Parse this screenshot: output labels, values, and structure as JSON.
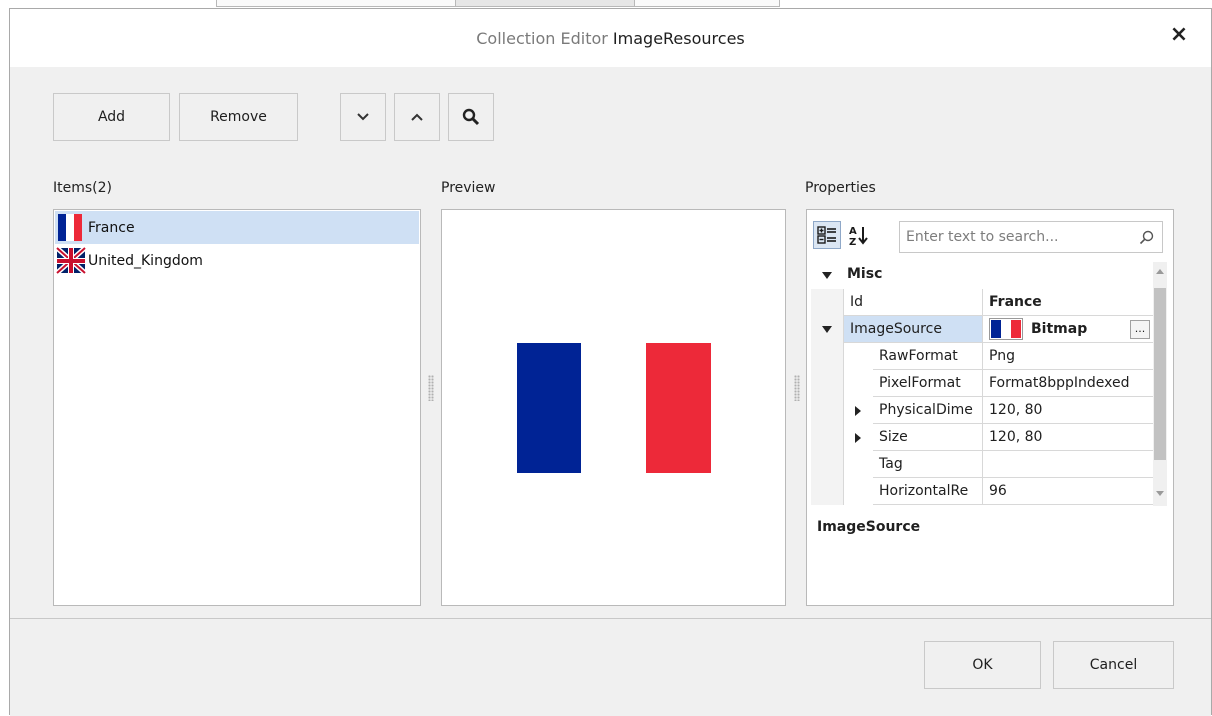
{
  "dialog": {
    "title_prefix": "Collection Editor",
    "title_name": "ImageResources",
    "close_glyph": "×"
  },
  "toolbar": {
    "add_label": "Add",
    "remove_label": "Remove",
    "move_down_icon": "chevron-down-icon",
    "move_up_icon": "chevron-up-icon",
    "search_icon": "magnifier-icon"
  },
  "items": {
    "header": "Items(2)",
    "list": [
      {
        "label": "France",
        "icon": "france-flag-icon",
        "selected": true
      },
      {
        "label": "United_Kingdom",
        "icon": "uk-flag-icon",
        "selected": false
      }
    ]
  },
  "preview": {
    "header": "Preview",
    "image": "france-flag",
    "colors": {
      "blue": "#002395",
      "white": "#ffffff",
      "red": "#ed2939"
    }
  },
  "properties": {
    "header": "Properties",
    "search_placeholder": "Enter text to search...",
    "category_label": "Misc",
    "rows": [
      {
        "name": "Id",
        "value": "France",
        "bold_value": true,
        "expander": "none",
        "level": 0
      },
      {
        "name": "ImageSource",
        "value": "Bitmap",
        "bold_value": true,
        "expander": "expanded",
        "level": 0,
        "selected": true,
        "has_ellipsis": true,
        "ellipsis_label": "..."
      },
      {
        "name": "RawFormat",
        "value": "Png",
        "expander": "none",
        "level": 1
      },
      {
        "name": "PixelFormat",
        "value": "Format8bppIndexed",
        "expander": "none",
        "level": 1
      },
      {
        "name": "PhysicalDime",
        "value": "120, 80",
        "expander": "collapsed",
        "level": 1
      },
      {
        "name": "Size",
        "value": "120, 80",
        "expander": "collapsed",
        "level": 1
      },
      {
        "name": "Tag",
        "value": "",
        "expander": "none",
        "level": 1
      },
      {
        "name": "HorizontalRe",
        "value": "96",
        "expander": "none",
        "level": 1
      }
    ],
    "description_title": "ImageSource"
  },
  "footer": {
    "ok_label": "OK",
    "cancel_label": "Cancel"
  }
}
